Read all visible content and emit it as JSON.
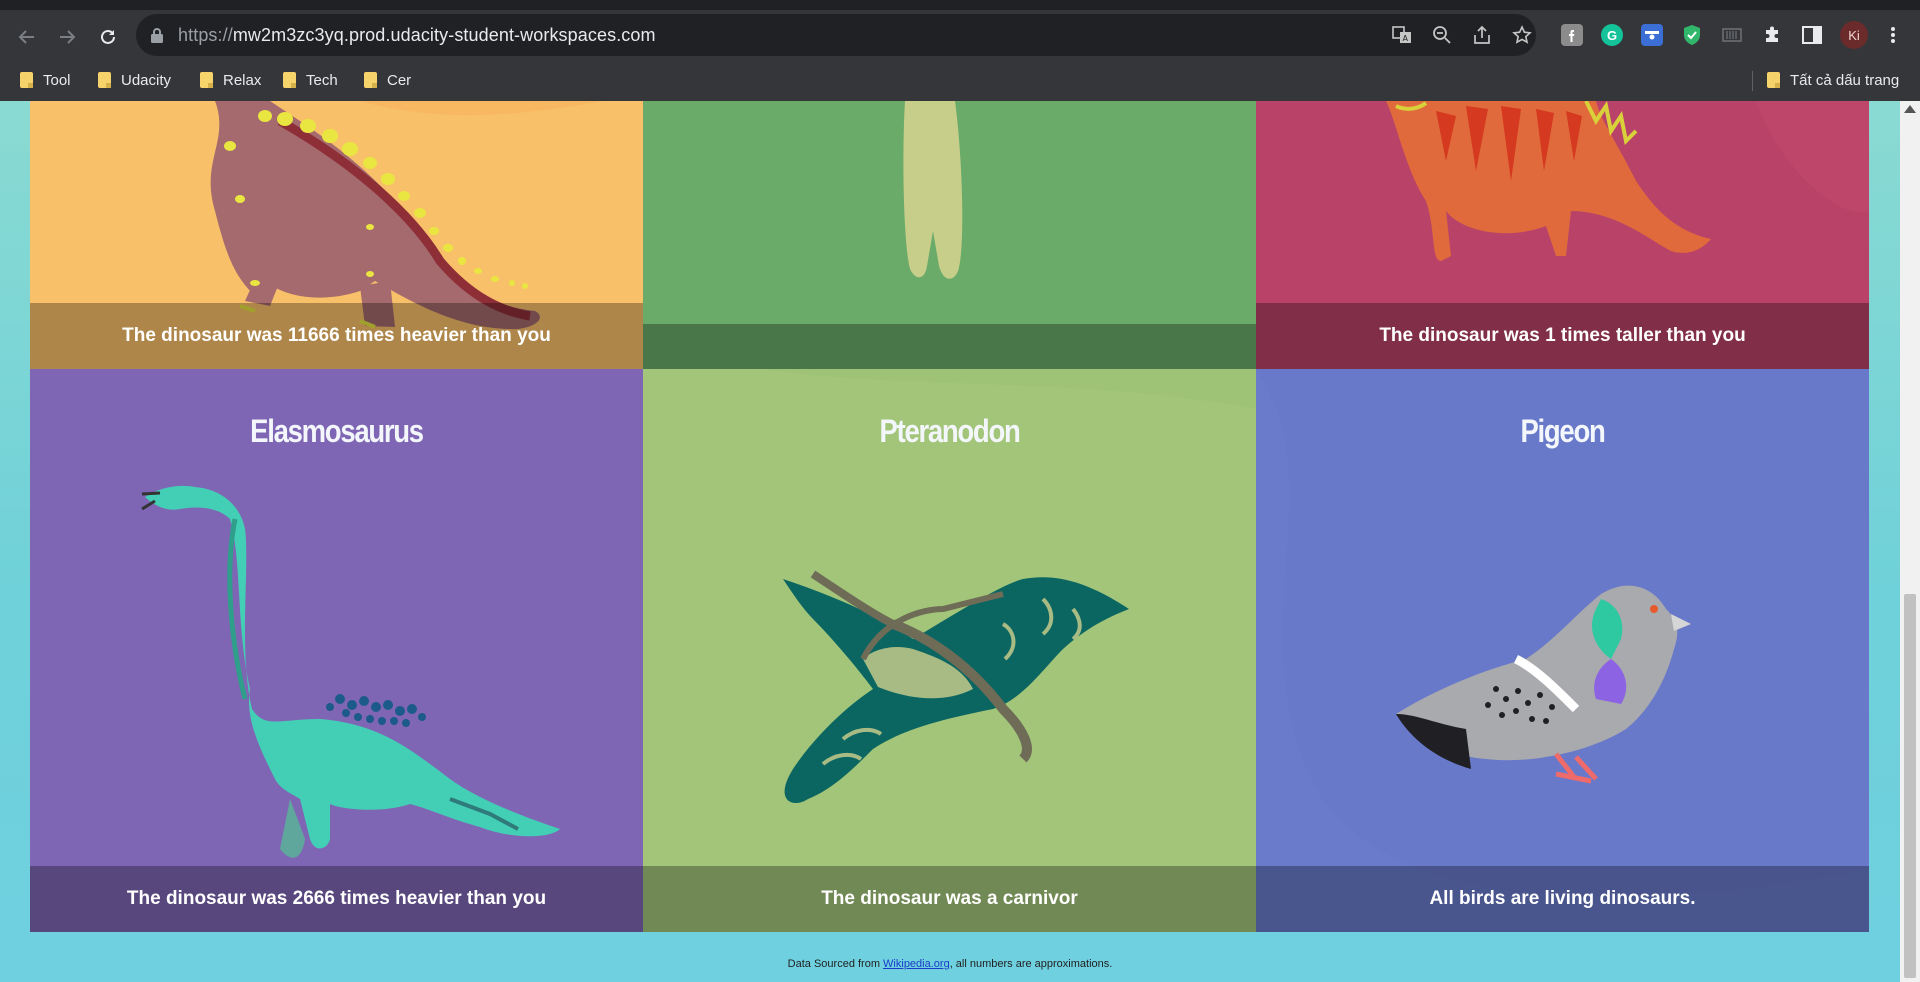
{
  "browser": {
    "url_protocol": "https://",
    "url_host": "mw2m3zc3yq.prod.udacity-student-workspaces.com",
    "profile_initials": "Ki",
    "bookmarks": [
      {
        "label": "Tool"
      },
      {
        "label": "Udacity"
      },
      {
        "label": "Relax"
      },
      {
        "label": "Tech"
      },
      {
        "label": "Cer"
      }
    ],
    "all_bookmarks_label": "Tất cả dấu trang"
  },
  "tiles_top": [
    {
      "fact": "The dinosaur was 11666 times heavier than you",
      "color": "#f9c06a"
    },
    {
      "fact": "",
      "color": "#6aab69"
    },
    {
      "fact": "The dinosaur was 1 times taller than you",
      "color": "#b94368"
    }
  ],
  "tiles_bottom": [
    {
      "name": "Elasmosaurus",
      "fact": "The dinosaur was 2666 times heavier than you",
      "color": "#7f66b4"
    },
    {
      "name": "Pteranodon",
      "fact": "The dinosaur was a carnivor",
      "color": "#a2c57a"
    },
    {
      "name": "Pigeon",
      "fact": "All birds are living dinosaurs.",
      "color": "#6979c9"
    }
  ],
  "footer": {
    "prefix": "Data Sourced from ",
    "link_text": "Wikipedia.org",
    "suffix": ", all numbers are approximations."
  },
  "icons": {
    "back": "back-arrow-icon",
    "forward": "forward-arrow-icon",
    "reload": "reload-icon",
    "lock": "lock-icon",
    "translate": "translate-icon",
    "zoom": "zoom-out-icon",
    "share": "share-icon",
    "bookmark": "star-icon",
    "extensions": "puzzle-icon",
    "side_panel": "side-panel-icon",
    "menu": "kebab-menu-icon"
  }
}
